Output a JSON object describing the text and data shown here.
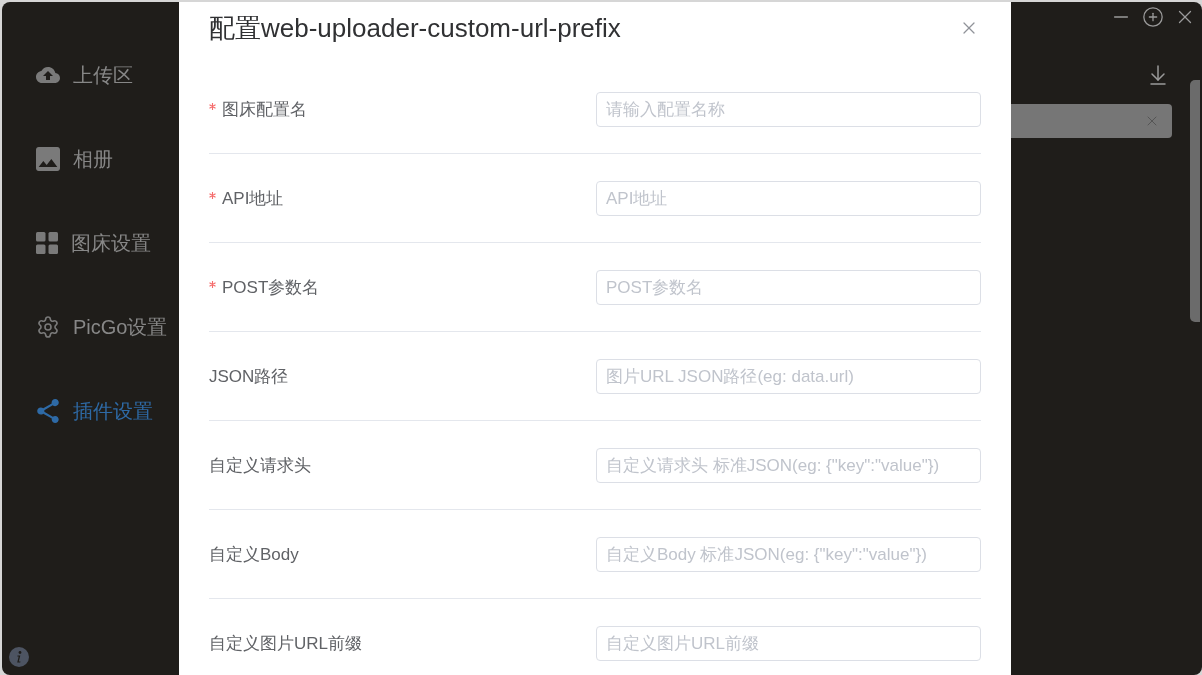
{
  "sidebar": {
    "items": [
      {
        "label": "上传区",
        "selected": false
      },
      {
        "label": "相册",
        "selected": false
      },
      {
        "label": "图床设置",
        "selected": false
      },
      {
        "label": "PicGo设置",
        "selected": false
      },
      {
        "label": "插件设置",
        "selected": true
      }
    ]
  },
  "dialog": {
    "title": "配置web-uploader-custom-url-prefix",
    "fields": [
      {
        "label": "图床配置名",
        "required": true,
        "placeholder": "请输入配置名称"
      },
      {
        "label": "API地址",
        "required": true,
        "placeholder": "API地址"
      },
      {
        "label": "POST参数名",
        "required": true,
        "placeholder": "POST参数名"
      },
      {
        "label": "JSON路径",
        "required": false,
        "placeholder": "图片URL JSON路径(eg: data.url)"
      },
      {
        "label": "自定义请求头",
        "required": false,
        "placeholder": "自定义请求头 标准JSON(eg: {\"key\":\"value\"})"
      },
      {
        "label": "自定义Body",
        "required": false,
        "placeholder": "自定义Body 标准JSON(eg: {\"key\":\"value\"})"
      },
      {
        "label": "自定义图片URL前缀",
        "required": false,
        "placeholder": "自定义图片URL前缀"
      }
    ]
  }
}
